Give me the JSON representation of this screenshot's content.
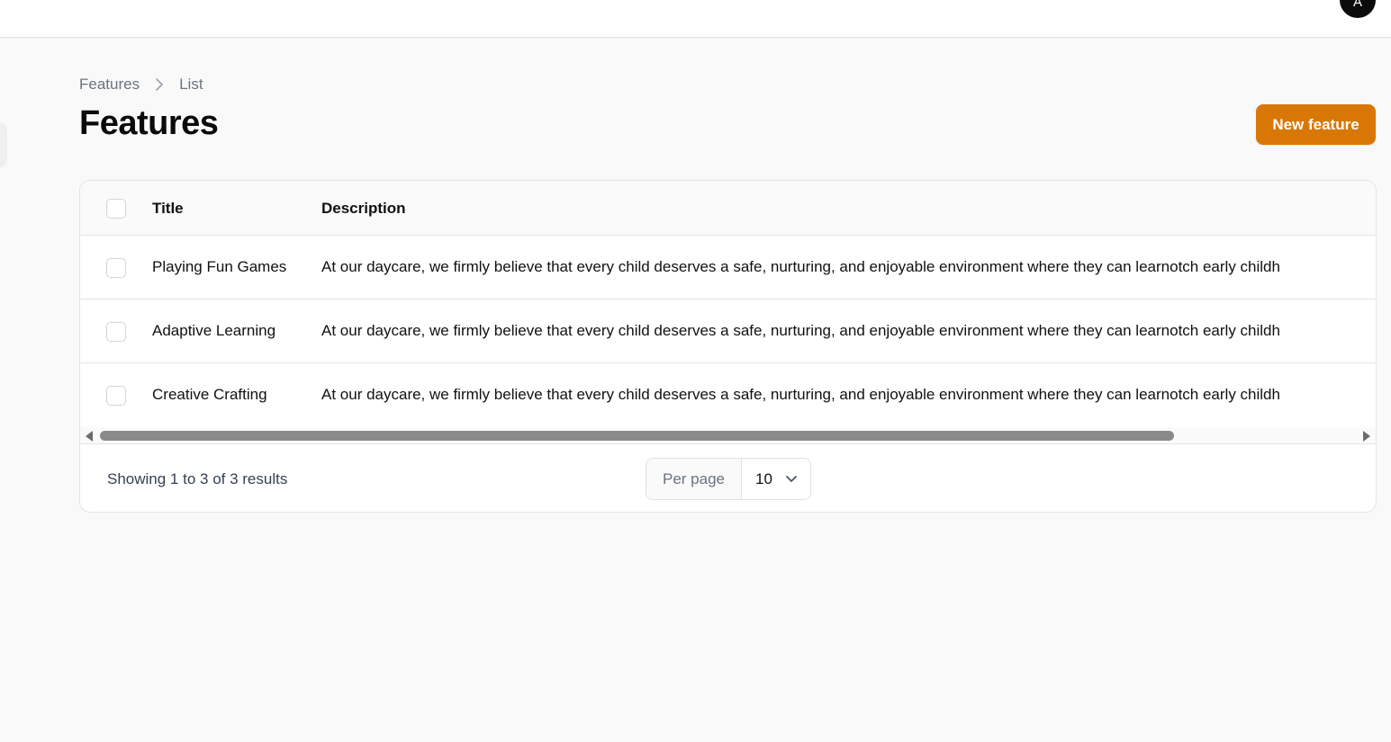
{
  "topbar": {
    "avatar_initial": "A"
  },
  "breadcrumb": {
    "items": [
      "Features",
      "List"
    ]
  },
  "page": {
    "title": "Features",
    "new_button_label": "New feature"
  },
  "table": {
    "columns": [
      "Title",
      "Description"
    ],
    "rows": [
      {
        "title": "Playing Fun Games",
        "description": "At our daycare, we firmly believe that every child deserves a safe, nurturing, and enjoyable environment where they can learnotch early childh"
      },
      {
        "title": "Adaptive Learning",
        "description": "At our daycare, we firmly believe that every child deserves a safe, nurturing, and enjoyable environment where they can learnotch early childh"
      },
      {
        "title": "Creative Crafting",
        "description": "At our daycare, we firmly believe that every child deserves a safe, nurturing, and enjoyable environment where they can learnotch early childh"
      }
    ]
  },
  "pagination": {
    "results_text": "Showing 1 to 3 of 3 results",
    "per_page_label": "Per page",
    "per_page_value": "10"
  },
  "colors": {
    "accent": "#d97706",
    "background": "#f9f9f9"
  }
}
